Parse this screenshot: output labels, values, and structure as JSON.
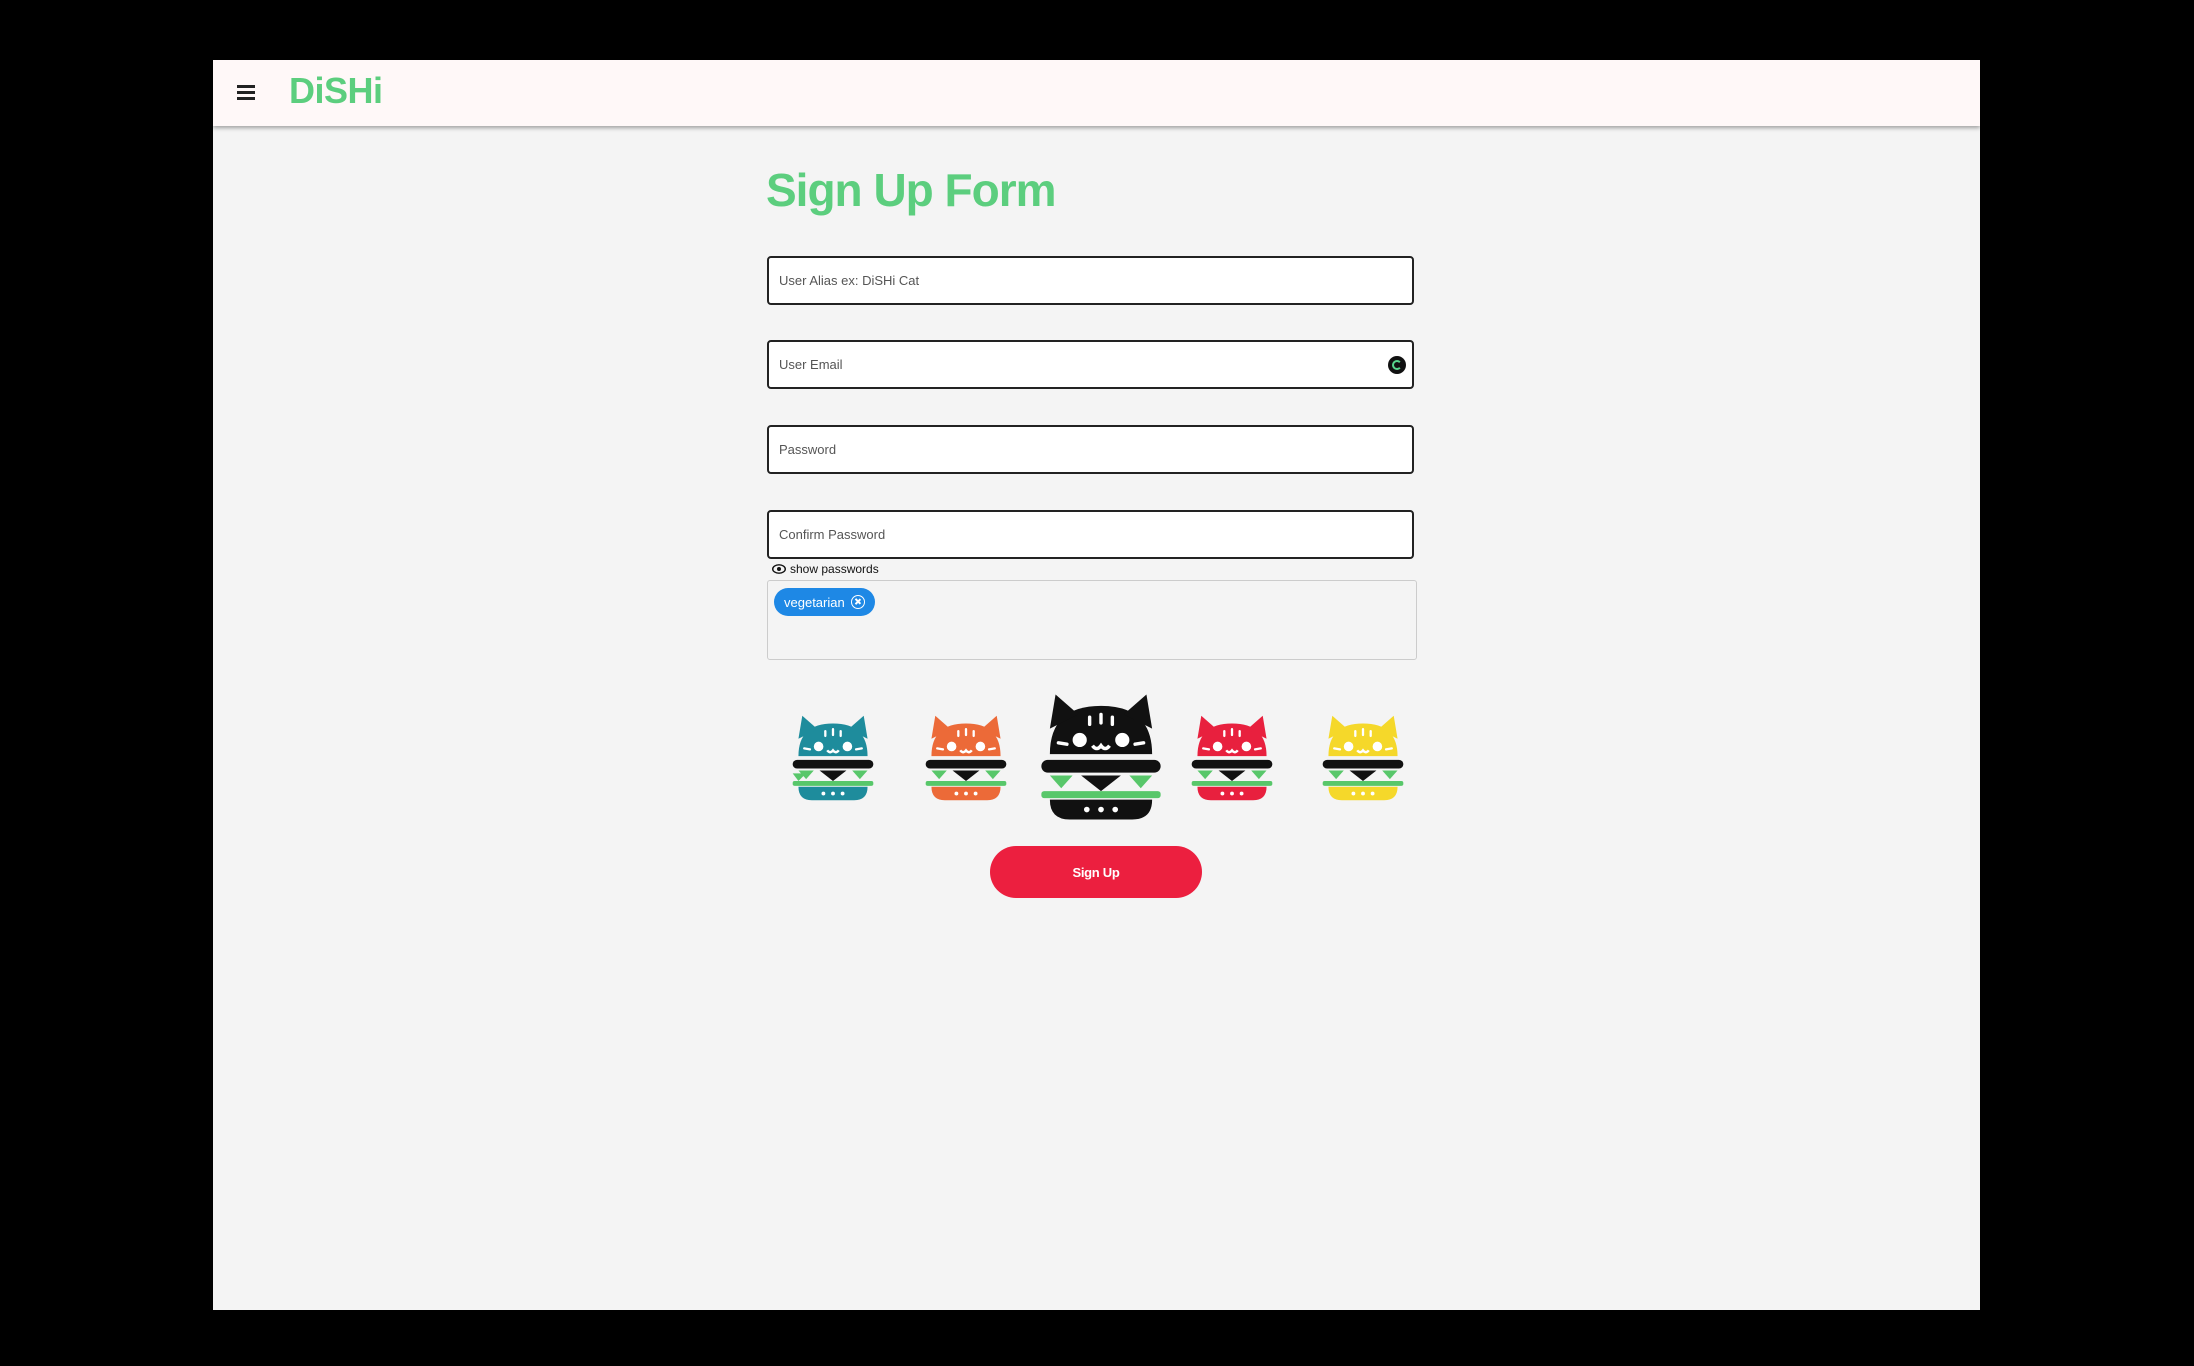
{
  "header": {
    "brand": "DiSHi",
    "menu_icon": "hamburger-menu-icon"
  },
  "form": {
    "title": "Sign Up Form",
    "alias_placeholder": "User Alias ex: DiSHi Cat",
    "email_placeholder": "User Email",
    "password_placeholder": "Password",
    "confirm_placeholder": "Confirm Password",
    "show_passwords_label": "show passwords",
    "tags": [
      "vegetarian"
    ],
    "submit_label": "Sign Up"
  },
  "avatars": [
    {
      "name": "teal-cat-burger-icon",
      "color": "#1e8c9c",
      "selected": false
    },
    {
      "name": "orange-cat-burger-icon",
      "color": "#ec6a38",
      "selected": false
    },
    {
      "name": "black-cat-burger-icon",
      "color": "#111111",
      "selected": true
    },
    {
      "name": "red-cat-burger-icon",
      "color": "#e8203e",
      "selected": false
    },
    {
      "name": "yellow-cat-burger-icon",
      "color": "#f5d82a",
      "selected": false
    }
  ],
  "colors": {
    "brand_green": "#5cce7e",
    "accent_red": "#ec1f3f",
    "chip_blue": "#1e88e5",
    "burger_green": "#58c76a"
  }
}
